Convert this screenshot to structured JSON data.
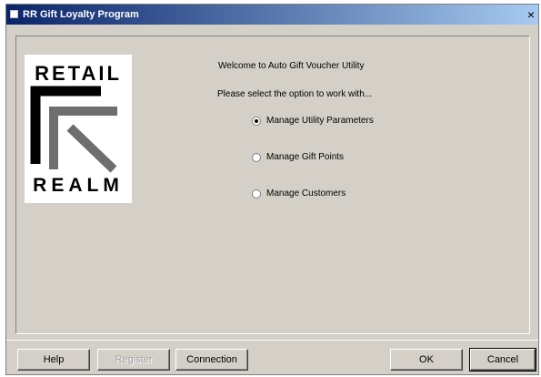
{
  "window": {
    "title": "RR Gift Loyalty Program",
    "close_label": "×"
  },
  "logo": {
    "top_text": "RETAIL",
    "bottom_text": "REALM"
  },
  "content": {
    "welcome": "Welcome to Auto Gift Voucher Utility",
    "instruction": "Please select the option to work with...",
    "options": [
      {
        "label": "Manage Utility Parameters",
        "selected": true
      },
      {
        "label": "Manage Gift Points",
        "selected": false
      },
      {
        "label": "Manage Customers",
        "selected": false
      }
    ]
  },
  "buttons": {
    "help": "Help",
    "register": "Register",
    "connection": "Connection",
    "ok": "OK",
    "cancel": "Cancel"
  }
}
